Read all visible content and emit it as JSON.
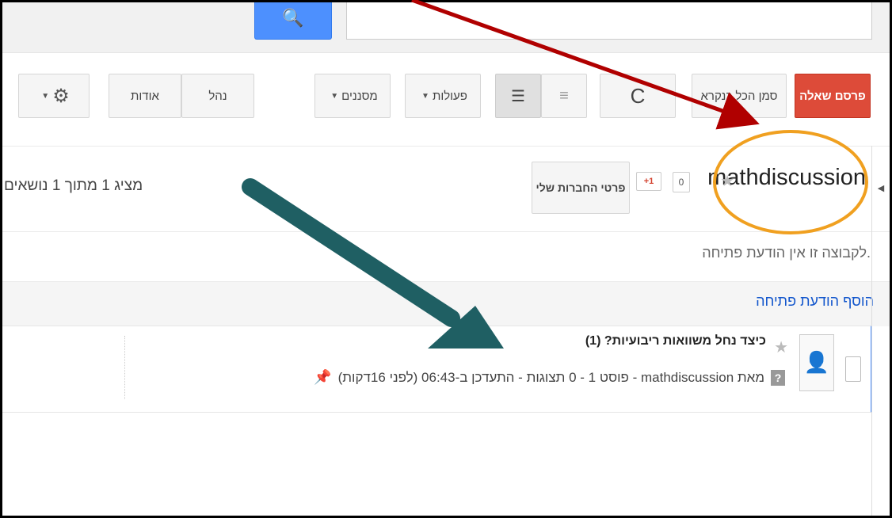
{
  "toolbar": {
    "post_question": "פרסם שאלה",
    "mark_all_read": "סמן הכל כנקרא",
    "refresh_icon": "refresh-icon",
    "actions": "פעולות",
    "filters": "מסננים",
    "manage": "נהל",
    "about": "אודות",
    "caret": "▼",
    "gear_icon": "gear-icon"
  },
  "group": {
    "name": "mathdiscussion",
    "plus_count": "0",
    "gplus_label": "+1",
    "membership_button": "פרטי החברות שלי",
    "topics_count": "מציג 1 מתוך 1 נושאים"
  },
  "welcome": {
    "no_message": "לקבוצה זו אין הודעת פתיחה.",
    "add_link": "הוסף הודעת פתיחה"
  },
  "topic": {
    "title": "כיצד נחל משוואות ריבועיות? (1)",
    "meta": "מאת mathdiscussion - פוסט 1 - 0 תצוגות - התעדכן ב-06:43 (לפני 16דקות)",
    "qmark": "?"
  },
  "colors": {
    "accent_blue": "#4d90fe",
    "post_red": "#dd4b39",
    "arrow_red": "#b00000",
    "arrow_teal": "#1f5f63",
    "circle_orange": "#f0a020"
  }
}
